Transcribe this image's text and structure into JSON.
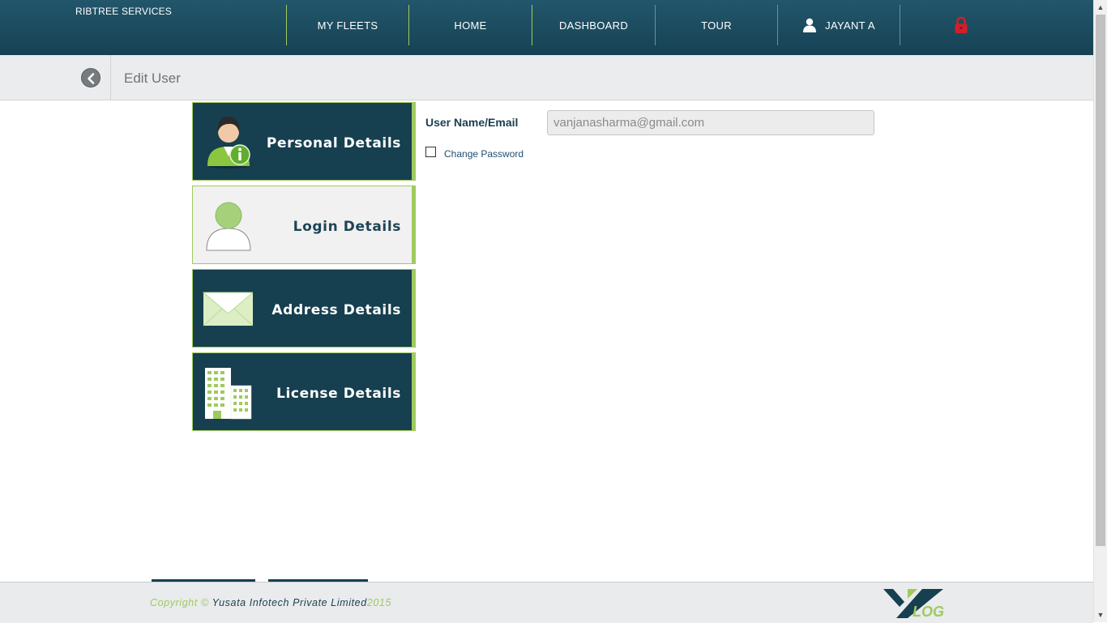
{
  "header": {
    "brand": "RIBTREE SERVICES",
    "nav": [
      {
        "label": "MY FLEETS"
      },
      {
        "label": "HOME"
      },
      {
        "label": "DASHBOARD"
      },
      {
        "label": "TOUR"
      }
    ],
    "user_name": "JAYANT A",
    "icons": {
      "user": "user-icon",
      "logout": "lock-icon"
    }
  },
  "subheader": {
    "title": "Edit User",
    "back_icon": "back-arrow-icon"
  },
  "sections": [
    {
      "label": "Personal Details",
      "icon": "person-info-icon",
      "selected": false
    },
    {
      "label": "Login Details",
      "icon": "person-silhouette-icon",
      "selected": true
    },
    {
      "label": "Address Details",
      "icon": "envelope-icon",
      "selected": false
    },
    {
      "label": "License Details",
      "icon": "building-icon",
      "selected": false
    }
  ],
  "form": {
    "username_label": "User Name/Email",
    "username_value": "vanjanasharma@gmail.com",
    "change_password_label": "Change Password",
    "change_password_checked": false
  },
  "footer": {
    "copyright_prefix": "Copyright ©",
    "company": "Yusata Infotech Private Limited",
    "year": "2015",
    "logo": "ylog-logo"
  },
  "colors": {
    "header_bg": "#1b4a5c",
    "accent_green": "#9fca5e",
    "tile_dark": "#163f4f",
    "logout_red": "#d21f2b"
  }
}
